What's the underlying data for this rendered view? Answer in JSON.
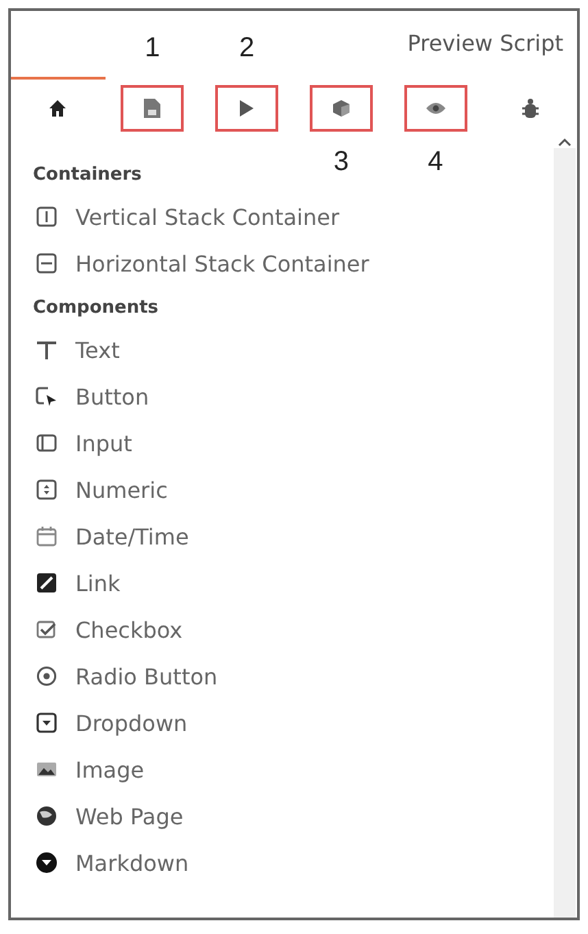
{
  "header": {
    "title": "Preview Script"
  },
  "tabs": [
    {
      "kind": "home",
      "selected": true
    },
    {
      "kind": "document",
      "selected": false,
      "callout_above": "1"
    },
    {
      "kind": "play",
      "selected": false,
      "callout_above": "2"
    },
    {
      "kind": "cube",
      "selected": false,
      "callout_below": "3"
    },
    {
      "kind": "eye",
      "selected": false,
      "callout_below": "4"
    },
    {
      "kind": "bug",
      "selected": false
    }
  ],
  "sections": [
    {
      "title": "Containers",
      "items": [
        {
          "kind": "vertical-stack",
          "label": "Vertical Stack Container"
        },
        {
          "kind": "horizontal-stack",
          "label": "Horizontal Stack Container"
        }
      ]
    },
    {
      "title": "Components",
      "items": [
        {
          "kind": "text",
          "label": "Text"
        },
        {
          "kind": "button",
          "label": "Button"
        },
        {
          "kind": "input",
          "label": "Input"
        },
        {
          "kind": "numeric",
          "label": "Numeric"
        },
        {
          "kind": "datetime",
          "label": "Date/Time"
        },
        {
          "kind": "link",
          "label": "Link"
        },
        {
          "kind": "checkbox",
          "label": "Checkbox"
        },
        {
          "kind": "radio",
          "label": "Radio Button"
        },
        {
          "kind": "dropdown",
          "label": "Dropdown"
        },
        {
          "kind": "image",
          "label": "Image"
        },
        {
          "kind": "webpage",
          "label": "Web Page"
        },
        {
          "kind": "markdown",
          "label": "Markdown"
        }
      ]
    }
  ]
}
